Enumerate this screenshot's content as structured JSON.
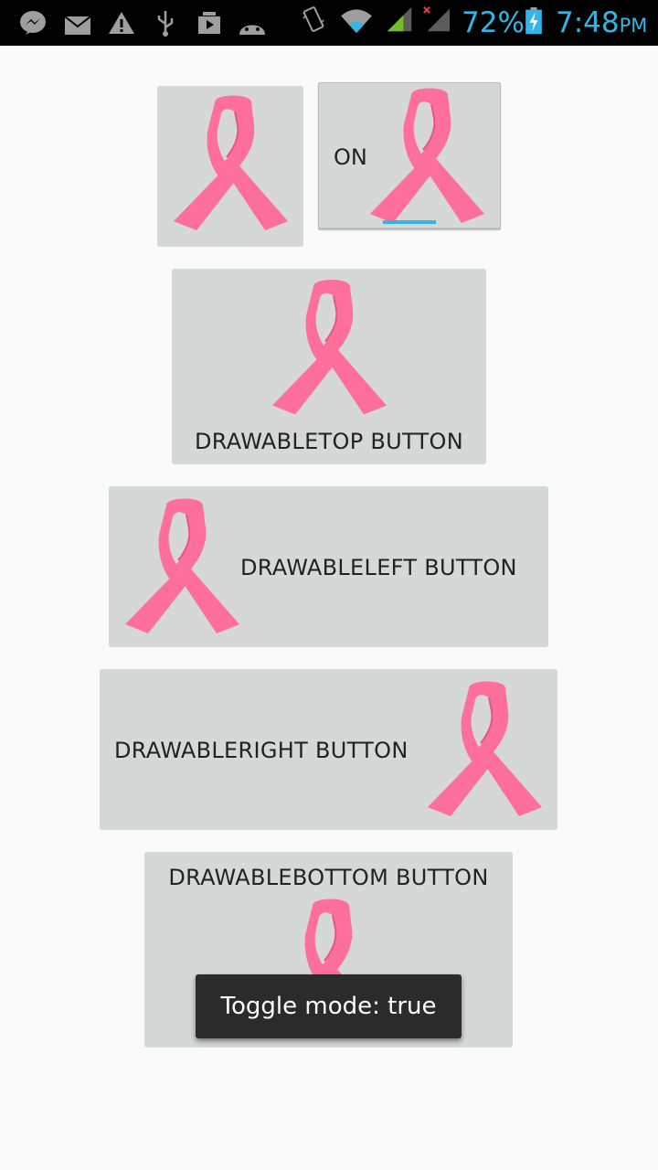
{
  "status_bar": {
    "battery": "72%",
    "time": "7:48",
    "ampm": "PM",
    "icons": [
      "messenger-icon",
      "mail-icon",
      "warning-icon",
      "usb-icon",
      "media-icon",
      "android-debug-icon",
      "vibrate-icon",
      "wifi-icon",
      "signal-icon",
      "signal-no-service-icon",
      "battery-charging-icon"
    ]
  },
  "buttons": {
    "toggle_label": "ON",
    "drawable_top": "DRAWABLETOP BUTTON",
    "drawable_left": "DRAWABLELEFT BUTTON",
    "drawable_right": "DRAWABLERIGHT BUTTON",
    "drawable_bottom": "DRAWABLEBOTTOM BUTTON"
  },
  "toast": {
    "text": "Toggle mode: true"
  },
  "colors": {
    "accent": "#33b5e5",
    "ribbon": "#ff6f9c",
    "button_bg": "#d6d7d7"
  }
}
